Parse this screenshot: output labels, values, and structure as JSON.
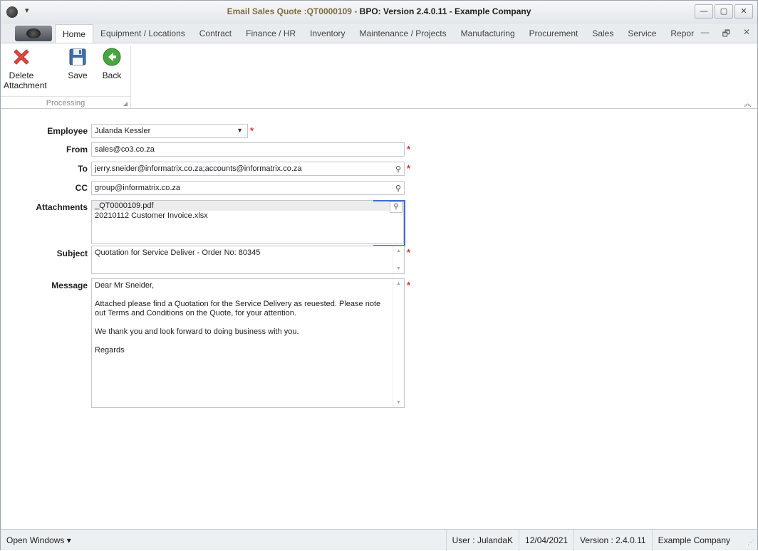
{
  "window": {
    "title_part1": "Email Sales Quote :QT0000109 - ",
    "title_part2": "BPO: Version 2.4.0.11 - Example Company",
    "minimize_glyph": "—",
    "maximize_glyph": "▢",
    "close_glyph": "✕",
    "qat_arrow": "▾"
  },
  "ribbon": {
    "tabs": [
      {
        "label": "Home"
      },
      {
        "label": "Equipment / Locations"
      },
      {
        "label": "Contract"
      },
      {
        "label": "Finance / HR"
      },
      {
        "label": "Inventory"
      },
      {
        "label": "Maintenance / Projects"
      },
      {
        "label": "Manufacturing"
      },
      {
        "label": "Procurement"
      },
      {
        "label": "Sales"
      },
      {
        "label": "Service"
      },
      {
        "label": "Repor"
      }
    ],
    "active_tab": "Home",
    "mdi_minimize": "—",
    "mdi_restore": "🗗",
    "mdi_close": "✕",
    "buttons": {
      "delete_attachment": "Delete\nAttachment",
      "delete_line1": "Delete",
      "delete_line2": "Attachment",
      "save": "Save",
      "back": "Back"
    },
    "group_label": "Processing",
    "collapse_glyph": "︽"
  },
  "form": {
    "employee": {
      "label": "Employee",
      "value": "Julanda Kessler"
    },
    "from": {
      "label": "From",
      "value": "sales@co3.co.za"
    },
    "to": {
      "label": "To",
      "value": "jerry.sneider@informatrix.co.za;accounts@informatrix.co.za"
    },
    "cc": {
      "label": "CC",
      "value": "group@informatrix.co.za"
    },
    "attachments": {
      "label": "Attachments",
      "items": [
        "_QT0000109.pdf",
        "20210112 Customer Invoice.xlsx"
      ]
    },
    "subject": {
      "label": "Subject",
      "value": "Quotation for Service Deliver - Order No: 80345"
    },
    "message": {
      "label": "Message",
      "lines": [
        "Dear Mr Sneider,",
        "",
        "Attached please find a Quotation for the Service Delivery as reuested.  Please note out Terms and Conditions on the Quote, for your attention.",
        "",
        "We thank you and look forward to doing business with you.",
        "",
        "Regards"
      ]
    },
    "required_mark": "*"
  },
  "statusbar": {
    "open_windows": "Open Windows ▾",
    "user": "User : JulandaK",
    "date": "12/04/2021",
    "version": "Version : 2.4.0.11",
    "company": "Example Company"
  },
  "colors": {
    "accent_focus": "#3d6fd1",
    "required": "#e03030",
    "delete_icon": "#e2483d",
    "save_icon": "#3f6faa",
    "back_icon": "#47a73e"
  }
}
